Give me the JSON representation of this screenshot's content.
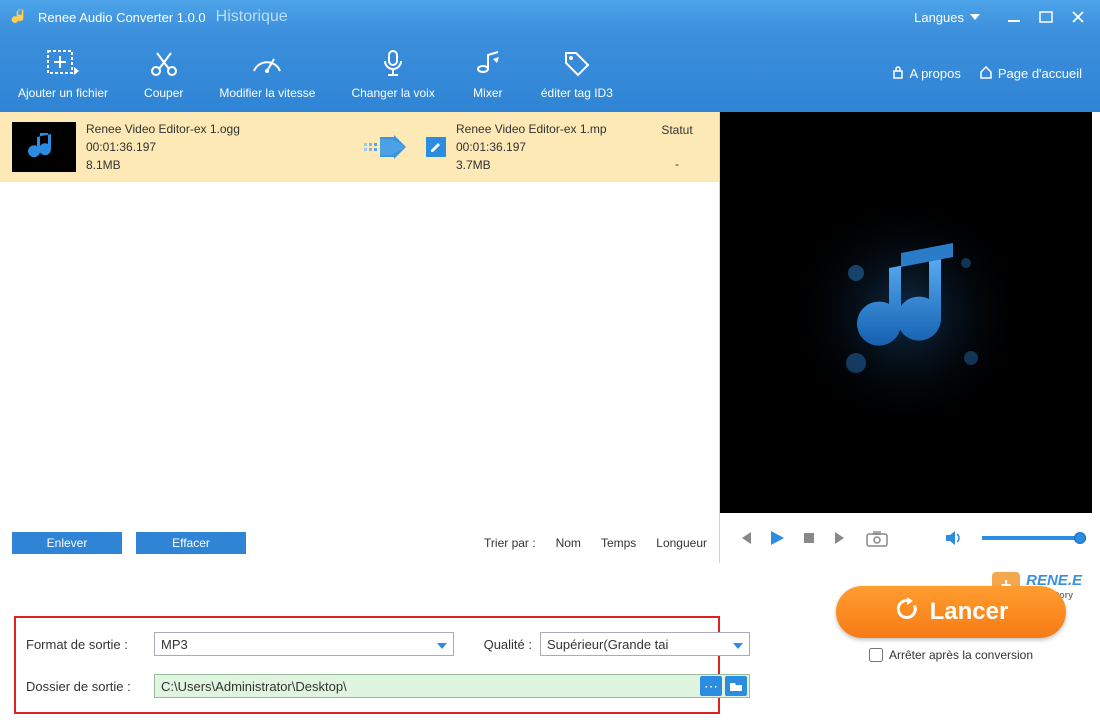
{
  "titlebar": {
    "app_name": "Renee Audio Converter 1.0.0",
    "history": "Historique",
    "languages": "Langues"
  },
  "toolbar": {
    "items": [
      {
        "label": "Ajouter un fichier"
      },
      {
        "label": "Couper"
      },
      {
        "label": "Modifier la vitesse"
      },
      {
        "label": "Changer la voix"
      },
      {
        "label": "Mixer"
      },
      {
        "label": "éditer tag ID3"
      }
    ],
    "about": "A propos",
    "home": "Page d'accueil"
  },
  "file": {
    "src_name": "Renee Video Editor-ex 1.ogg",
    "src_duration": "00:01:36.197",
    "src_size": "8.1MB",
    "dst_name": "Renee Video Editor-ex 1.mp",
    "dst_duration": "00:01:36.197",
    "dst_size": "3.7MB",
    "status_header": "Statut",
    "status_value": "-"
  },
  "buttons": {
    "remove": "Enlever",
    "clear": "Effacer"
  },
  "sort": {
    "label": "Trier par :",
    "name": "Nom",
    "time": "Temps",
    "length": "Longueur"
  },
  "output": {
    "format_label": "Format de sortie :",
    "format_value": "MP3",
    "quality_label": "Qualité :",
    "quality_value": "Supérieur(Grande tai",
    "folder_label": "Dossier de sortie :",
    "folder_value": "C:\\Users\\Administrator\\Desktop\\"
  },
  "launch": {
    "button": "Lancer",
    "stop_after": "Arrêter après la conversion"
  },
  "brand": {
    "name": "RENE.E",
    "sub": "Laboratory"
  }
}
